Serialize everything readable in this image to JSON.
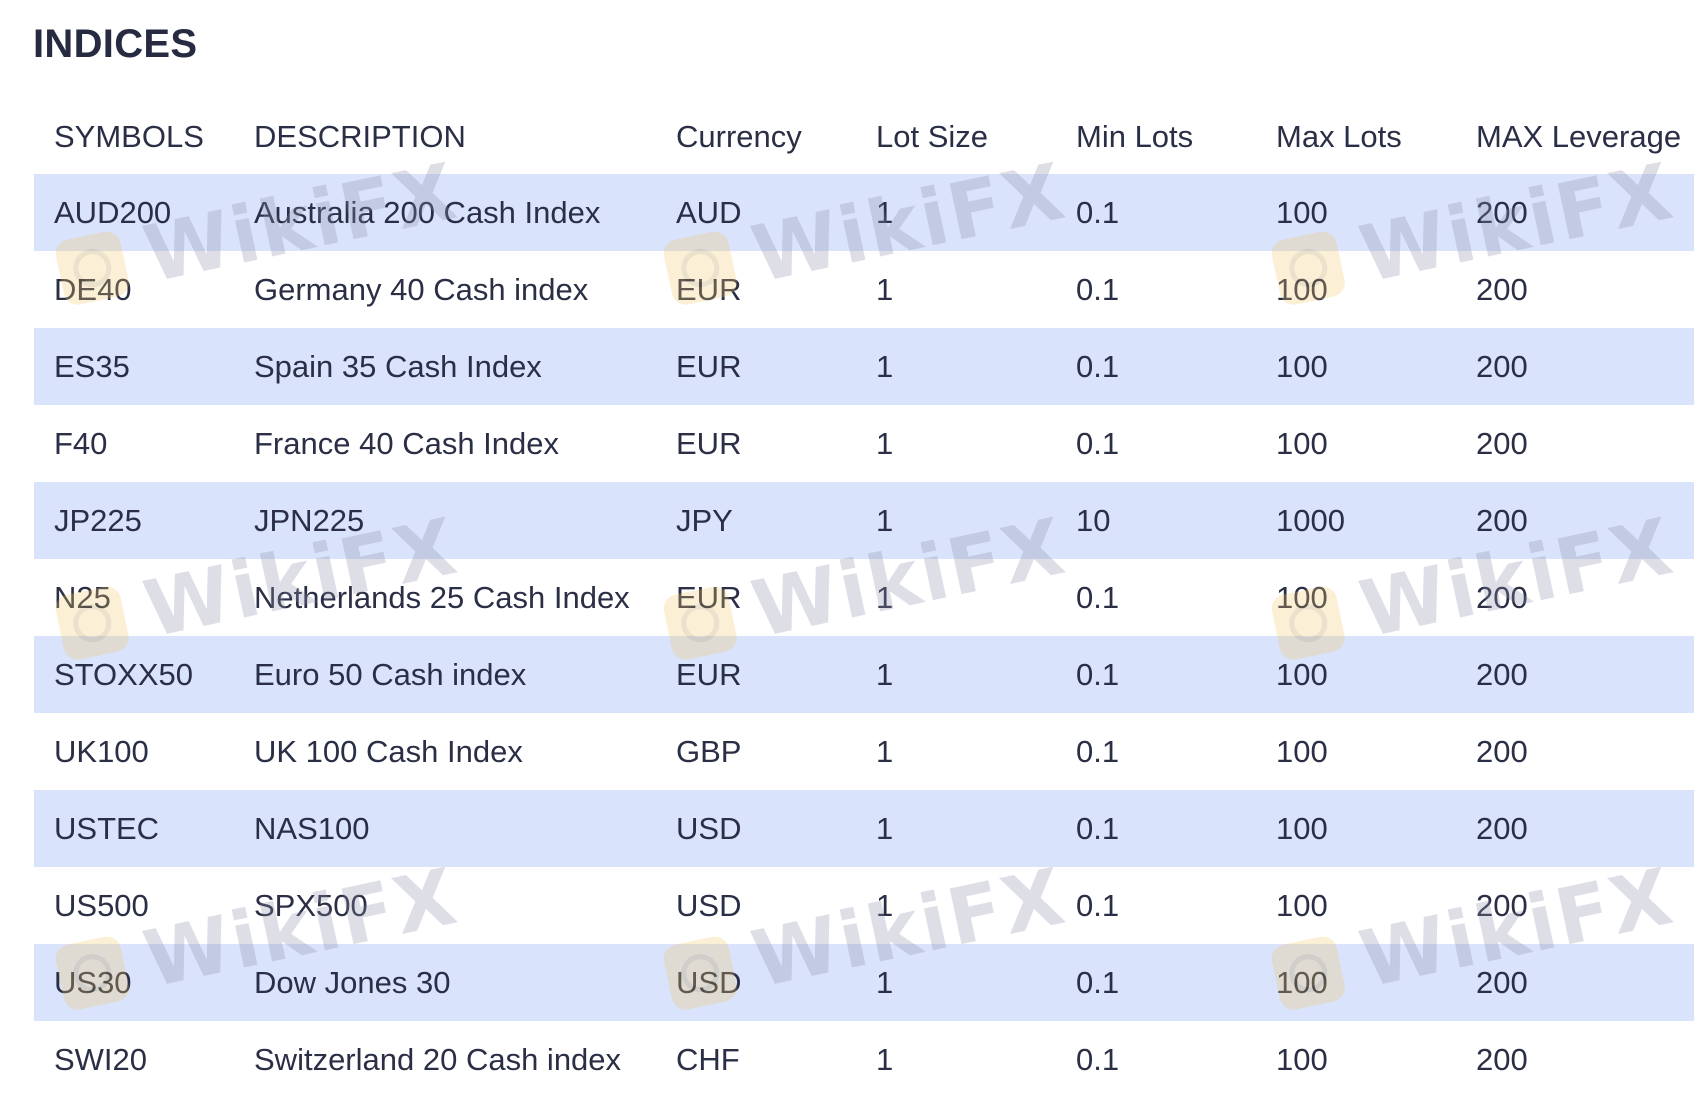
{
  "title": "INDICES",
  "table": {
    "headers": [
      "SYMBOLS",
      "DESCRIPTION",
      "Currency",
      "Lot Size",
      "Min Lots",
      "Max Lots",
      "MAX Leverage"
    ],
    "rows": [
      [
        "AUD200",
        "Australia 200 Cash Index",
        "AUD",
        "1",
        "0.1",
        "100",
        "200"
      ],
      [
        "DE40",
        "Germany 40 Cash index",
        "EUR",
        "1",
        "0.1",
        "100",
        "200"
      ],
      [
        "ES35",
        "Spain 35 Cash Index",
        "EUR",
        "1",
        "0.1",
        "100",
        "200"
      ],
      [
        "F40",
        "France 40 Cash Index",
        "EUR",
        "1",
        "0.1",
        "100",
        "200"
      ],
      [
        "JP225",
        "JPN225",
        "JPY",
        "1",
        "10",
        "1000",
        "200"
      ],
      [
        "N25",
        "Netherlands 25 Cash Index",
        "EUR",
        "1",
        "0.1",
        "100",
        "200"
      ],
      [
        "STOXX50",
        "Euro 50 Cash index",
        "EUR",
        "1",
        "0.1",
        "100",
        "200"
      ],
      [
        "UK100",
        "UK 100 Cash Index",
        "GBP",
        "1",
        "0.1",
        "100",
        "200"
      ],
      [
        "USTEC",
        "NAS100",
        "USD",
        "1",
        "0.1",
        "100",
        "200"
      ],
      [
        "US500",
        "SPX500",
        "USD",
        "1",
        "0.1",
        "100",
        "200"
      ],
      [
        "US30",
        "Dow Jones 30",
        "USD",
        "1",
        "0.1",
        "100",
        "200"
      ],
      [
        "SWI20",
        "Switzerland 20 Cash index",
        "CHF",
        "1",
        "0.1",
        "100",
        "200"
      ]
    ]
  },
  "watermark": {
    "text": "WikiFX"
  },
  "colors": {
    "shaded_row": "#d9e3fb",
    "text": "#2a2f45",
    "title": "#262b42"
  }
}
